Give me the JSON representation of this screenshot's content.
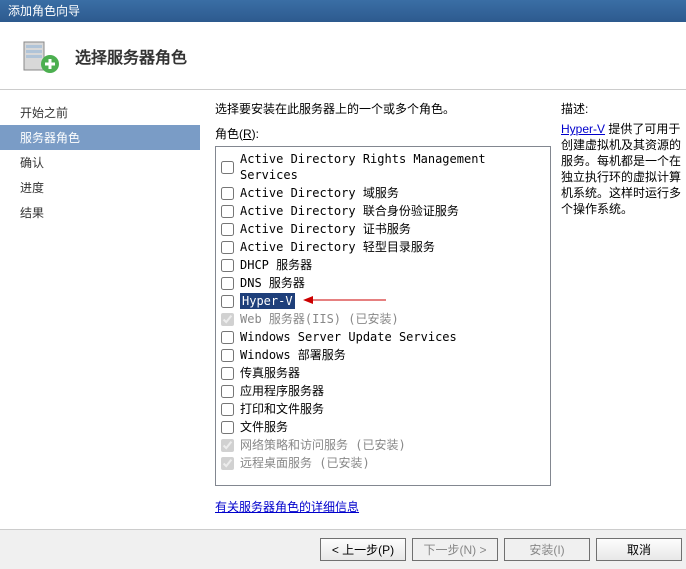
{
  "window": {
    "title": "添加角色向导"
  },
  "header": {
    "title": "选择服务器角色"
  },
  "sidebar": {
    "items": [
      {
        "label": "开始之前",
        "active": false
      },
      {
        "label": "服务器角色",
        "active": true
      },
      {
        "label": "确认",
        "active": false
      },
      {
        "label": "进度",
        "active": false
      },
      {
        "label": "结果",
        "active": false
      }
    ]
  },
  "main": {
    "instruction": "选择要安装在此服务器上的一个或多个角色。",
    "roles_label": "角色(R):",
    "roles": [
      {
        "label": "Active Directory Rights Management Services",
        "checked": false,
        "disabled": false,
        "highlighted": false
      },
      {
        "label": "Active Directory 域服务",
        "checked": false,
        "disabled": false,
        "highlighted": false
      },
      {
        "label": "Active Directory 联合身份验证服务",
        "checked": false,
        "disabled": false,
        "highlighted": false
      },
      {
        "label": "Active Directory 证书服务",
        "checked": false,
        "disabled": false,
        "highlighted": false
      },
      {
        "label": "Active Directory 轻型目录服务",
        "checked": false,
        "disabled": false,
        "highlighted": false
      },
      {
        "label": "DHCP 服务器",
        "checked": false,
        "disabled": false,
        "highlighted": false
      },
      {
        "label": "DNS 服务器",
        "checked": false,
        "disabled": false,
        "highlighted": false
      },
      {
        "label": "Hyper-V",
        "checked": false,
        "disabled": false,
        "highlighted": true
      },
      {
        "label": "Web 服务器(IIS)  (已安装)",
        "checked": true,
        "disabled": true,
        "highlighted": false
      },
      {
        "label": "Windows Server Update Services",
        "checked": false,
        "disabled": false,
        "highlighted": false
      },
      {
        "label": "Windows 部署服务",
        "checked": false,
        "disabled": false,
        "highlighted": false
      },
      {
        "label": "传真服务器",
        "checked": false,
        "disabled": false,
        "highlighted": false
      },
      {
        "label": "应用程序服务器",
        "checked": false,
        "disabled": false,
        "highlighted": false
      },
      {
        "label": "打印和文件服务",
        "checked": false,
        "disabled": false,
        "highlighted": false
      },
      {
        "label": "文件服务",
        "checked": false,
        "disabled": false,
        "highlighted": false
      },
      {
        "label": "网络策略和访问服务  (已安装)",
        "checked": true,
        "disabled": true,
        "highlighted": false
      },
      {
        "label": "远程桌面服务  (已安装)",
        "checked": true,
        "disabled": true,
        "highlighted": false
      }
    ],
    "info_link": "有关服务器角色的详细信息"
  },
  "description": {
    "title": "描述:",
    "link_text": "Hyper-V",
    "body": " 提供了可用于创建虚拟机及其资源的服务。每机都是一个在独立执行环的虚拟计算机系统。这样时运行多个操作系统。"
  },
  "footer": {
    "prev": "< 上一步(P)",
    "next": "下一步(N) >",
    "install": "安装(I)",
    "cancel": "取消"
  }
}
